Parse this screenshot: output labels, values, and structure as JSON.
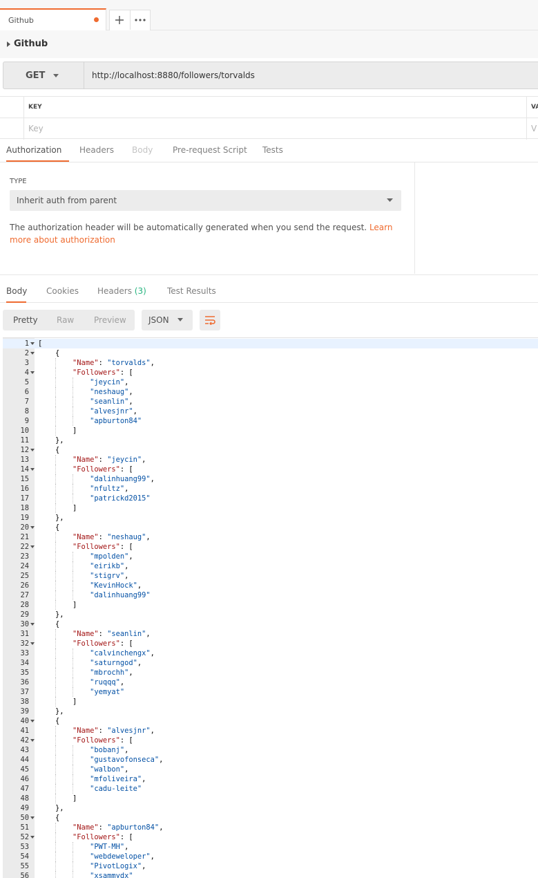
{
  "tab": {
    "label": "Github"
  },
  "collection": {
    "name": "Github"
  },
  "request": {
    "method": "GET",
    "url": "http://localhost:8880/followers/torvalds"
  },
  "params": {
    "key_header": "KEY",
    "value_header": "VA",
    "key_placeholder": "Key",
    "value_placeholder": "V"
  },
  "request_tabs": [
    {
      "label": "Authorization",
      "state": "active"
    },
    {
      "label": "Headers",
      "state": "normal"
    },
    {
      "label": "Body",
      "state": "disabled"
    },
    {
      "label": "Pre-request Script",
      "state": "normal"
    },
    {
      "label": "Tests",
      "state": "normal"
    }
  ],
  "auth": {
    "type_label": "TYPE",
    "type_value": "Inherit auth from parent",
    "note": "The authorization header will be automatically generated when you send the request. ",
    "link": "Learn more about authorization"
  },
  "response_tabs": {
    "body": "Body",
    "cookies": "Cookies",
    "headers": "Headers",
    "headers_count": "(3)",
    "test_results": "Test Results"
  },
  "response_view": {
    "modes": [
      "Pretty",
      "Raw",
      "Preview"
    ],
    "active_mode": "Pretty",
    "format": "JSON"
  },
  "response_body": [
    {
      "name": "torvalds",
      "followers": [
        "jeycin",
        "neshaug",
        "seanlin",
        "alvesjnr",
        "apburton84"
      ]
    },
    {
      "name": "jeycin",
      "followers": [
        "dalinhuang99",
        "nfultz",
        "patrickd2015"
      ]
    },
    {
      "name": "neshaug",
      "followers": [
        "mpolden",
        "eirikb",
        "stigrv",
        "KevinHock",
        "dalinhuang99"
      ]
    },
    {
      "name": "seanlin",
      "followers": [
        "calvinchengx",
        "saturngod",
        "mbrochh",
        "ruqqq",
        "yemyat"
      ]
    },
    {
      "name": "alvesjnr",
      "followers": [
        "bobanj",
        "gustavofonseca",
        "walbon",
        "mfoliveira",
        "cadu-leite"
      ]
    },
    {
      "name": "apburton84",
      "followers": [
        "PWT-MH",
        "webdeweloper",
        "PivotLogix",
        "xsammydx"
      ]
    }
  ],
  "colors": {
    "accent": "#ef6b30",
    "json_key": "#a31515",
    "json_string": "#0451a5",
    "count": "#26b47f"
  }
}
